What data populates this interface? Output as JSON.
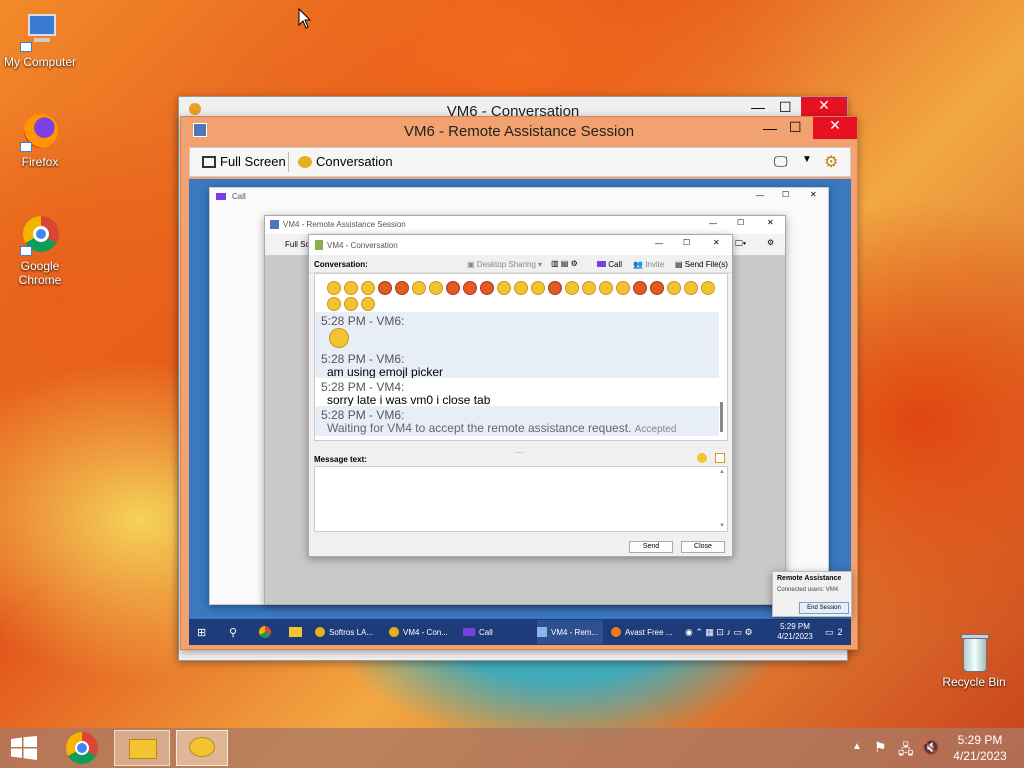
{
  "desktop": {
    "icons": [
      {
        "label": "My Computer"
      },
      {
        "label": "Firefox"
      },
      {
        "label": "Google Chrome"
      },
      {
        "label": "Recycle Bin"
      }
    ]
  },
  "outer_conversation": {
    "title": "VM6 - Conversation"
  },
  "remote_session": {
    "title": "VM6 - Remote Assistance Session",
    "fullscreen_label": "Full Screen",
    "conversation_label": "Conversation"
  },
  "call_window": {
    "title": "Call"
  },
  "inner_session": {
    "title": "VM4 - Remote Assistance Session",
    "fullscreen_label": "Full Sc"
  },
  "chat": {
    "title": "VM4 - Conversation",
    "conversation_label": "Conversation:",
    "toolbar": {
      "desktop_sharing": "Desktop Sharing",
      "call": "Call",
      "invite": "Invite",
      "send_files": "Send File(s)"
    },
    "messages": [
      {
        "header": "5:28 PM - VM6:",
        "text": ""
      },
      {
        "header": "5:28 PM - VM6:",
        "text": "am using emojl picker"
      },
      {
        "header": "5:28 PM - VM4:",
        "text": "sorry late i was vm0 i close tab"
      },
      {
        "header": "5:28 PM - VM6:",
        "text": "Waiting for VM4 to accept the remote assistance request.",
        "status": "Accepted"
      }
    ],
    "message_label": "Message text:",
    "send_label": "Send",
    "close_label": "Close"
  },
  "ra_popup": {
    "title": "Remote Assistance",
    "connected": "Connected users: VM4",
    "end_label": "End Session"
  },
  "inner_taskbar": {
    "items": [
      "Softros LA...",
      "VM4 - Con...",
      "Call",
      "VM4 - Rem...",
      "Avast Free ..."
    ],
    "time": "5:29 PM",
    "date": "4/21/2023",
    "notif_count": "2"
  },
  "taskbar": {
    "time": "5:29 PM",
    "date": "4/21/2023"
  }
}
